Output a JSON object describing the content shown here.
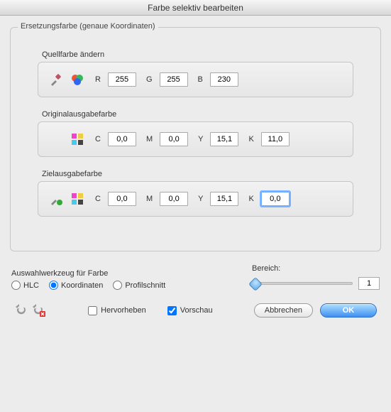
{
  "window": {
    "title": "Farbe selektiv bearbeiten"
  },
  "group": {
    "label": "Ersetzungsfarbe (genaue Koordinaten)"
  },
  "source": {
    "title": "Quellfarbe ändern",
    "labels": {
      "r": "R",
      "g": "G",
      "b": "B"
    },
    "r": "255",
    "g": "255",
    "b": "230"
  },
  "original": {
    "title": "Originalausgabefarbe",
    "labels": {
      "c": "C",
      "m": "M",
      "y": "Y",
      "k": "K"
    },
    "c": "0,0",
    "m": "0,0",
    "y": "15,1",
    "k": "11,0"
  },
  "target": {
    "title": "Zielausgabefarbe",
    "labels": {
      "c": "C",
      "m": "M",
      "y": "Y",
      "k": "K"
    },
    "c": "0,0",
    "m": "0,0",
    "y": "15,1",
    "k": "0,0"
  },
  "tool": {
    "label": "Auswahlwerkzeug für Farbe",
    "hlc": "HLC",
    "koord": "Koordinaten",
    "profil": "Profilschnitt"
  },
  "range": {
    "label": "Bereich:",
    "value": "1"
  },
  "footer": {
    "hervorheben": "Hervorheben",
    "vorschau": "Vorschau",
    "cancel": "Abbrechen",
    "ok": "OK"
  }
}
